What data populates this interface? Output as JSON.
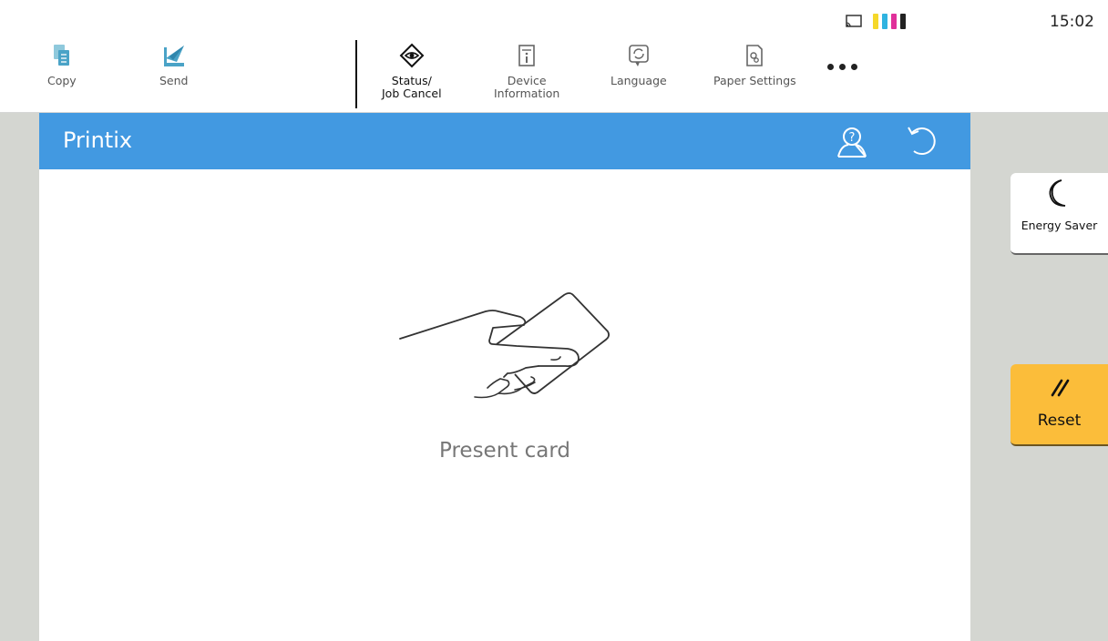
{
  "status": {
    "clock": "15:02",
    "toner_colors": [
      "#f5d82a",
      "#2fb3e0",
      "#e0309a",
      "#222222"
    ]
  },
  "nav": {
    "copy_label": "Copy",
    "send_label": "Send",
    "status_label_1": "Status/",
    "status_label_2": "Job Cancel",
    "device_label_1": "Device",
    "device_label_2": "Information",
    "language_label": "Language",
    "paper_label": "Paper Settings"
  },
  "panel": {
    "title": "Printix",
    "message": "Present card",
    "header_color": "#4299e1"
  },
  "side": {
    "energy_label": "Energy Saver",
    "reset_label": "Reset",
    "reset_color": "#fbbd3a"
  },
  "icons": [
    "cast-icon",
    "copy-icon",
    "send-icon",
    "status-eye-icon",
    "info-icon",
    "language-icon",
    "paper-settings-icon",
    "more-icon",
    "help-user-icon",
    "back-icon",
    "moon-icon",
    "reset-slash-icon",
    "hand-card-icon"
  ]
}
